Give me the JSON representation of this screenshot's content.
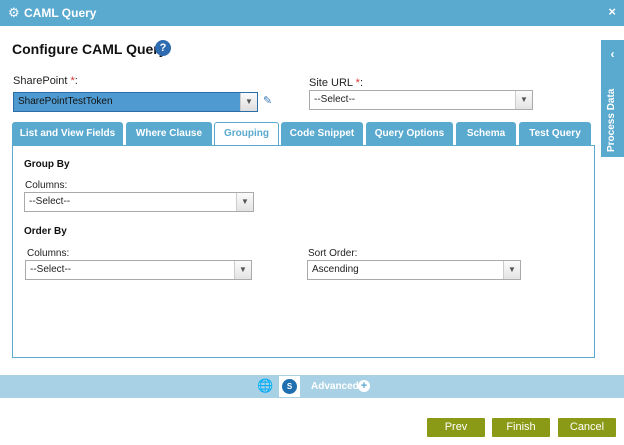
{
  "window": {
    "title": "CAML Query",
    "gear_icon": "⚙",
    "close_icon": "×"
  },
  "header": {
    "title": "Configure CAML Query",
    "help_icon": "?"
  },
  "form": {
    "sharepoint": {
      "label": "SharePoint ",
      "required_mark": "*",
      "label_suffix": ":",
      "value": "SharePointTestToken"
    },
    "site_url": {
      "label": "Site URL ",
      "required_mark": "*",
      "label_suffix": ":",
      "value": "--Select--"
    }
  },
  "side_panel": {
    "label": "Process Data",
    "chevron": "‹"
  },
  "tabs": [
    {
      "label": "List and View Fields"
    },
    {
      "label": "Where Clause"
    },
    {
      "label": "Grouping",
      "active": true
    },
    {
      "label": "Code Snippet"
    },
    {
      "label": "Query Options"
    },
    {
      "label": "Schema"
    },
    {
      "label": "Test Query"
    }
  ],
  "grouping": {
    "group_by": {
      "title": "Group By",
      "columns_label": "Columns:",
      "columns_value": "--Select--"
    },
    "order_by": {
      "title": "Order By",
      "columns_label": "Columns:",
      "columns_value": "--Select--",
      "sort_order_label": "Sort Order:",
      "sort_order_value": "Ascending"
    }
  },
  "bottom_bar": {
    "advanced_label": "Advanced",
    "plus_icon": "+",
    "sp_icon": "S"
  },
  "buttons": {
    "prev": "Prev",
    "finish": "Finish",
    "cancel": "Cancel"
  },
  "colors": {
    "accent": "#5aa9cf",
    "button": "#8b9a16",
    "highlight": "#4f9bd1",
    "required": "#dd3333"
  }
}
